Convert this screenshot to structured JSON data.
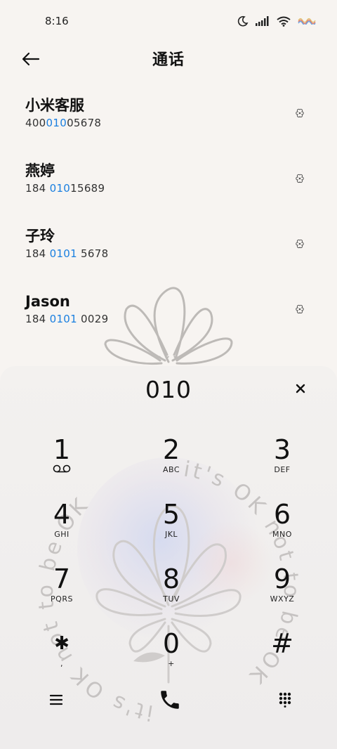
{
  "status": {
    "time": "8:16"
  },
  "header": {
    "title": "通话"
  },
  "results": [
    {
      "name": "小米客服",
      "num_pre": "400",
      "num_hl": "010",
      "num_post": "05678"
    },
    {
      "name": "燕婷",
      "num_pre": "184 ",
      "num_hl": "010",
      "num_post": "15689"
    },
    {
      "name": "子玲",
      "num_pre": "184 ",
      "num_hl": "0101",
      "num_post": " 5678"
    },
    {
      "name": "Jason",
      "num_pre": "184 ",
      "num_hl": "0101",
      "num_post": " 0029"
    }
  ],
  "dialpad": {
    "digits": "010",
    "keys": [
      {
        "num": "1",
        "letters": ""
      },
      {
        "num": "2",
        "letters": "ABC"
      },
      {
        "num": "3",
        "letters": "DEF"
      },
      {
        "num": "4",
        "letters": "GHI"
      },
      {
        "num": "5",
        "letters": "JKL"
      },
      {
        "num": "6",
        "letters": "MNO"
      },
      {
        "num": "7",
        "letters": "PQRS"
      },
      {
        "num": "8",
        "letters": "TUV"
      },
      {
        "num": "9",
        "letters": "WXYZ"
      },
      {
        "num": "✱",
        "letters": ","
      },
      {
        "num": "0",
        "letters": "+"
      },
      {
        "num": "#",
        "letters": ""
      }
    ]
  },
  "watermark": {
    "text": "it's OK not to be OK"
  },
  "colors": {
    "highlight": "#1a7fe0",
    "background": "#f7f4f1"
  }
}
